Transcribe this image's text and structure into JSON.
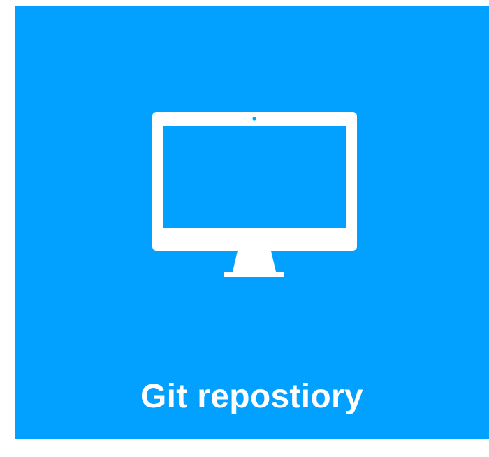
{
  "tile": {
    "label": "Git repostiory",
    "icon": "desktop-monitor-icon",
    "background_color": "#03A1FF",
    "foreground_color": "#FFFFFF"
  }
}
